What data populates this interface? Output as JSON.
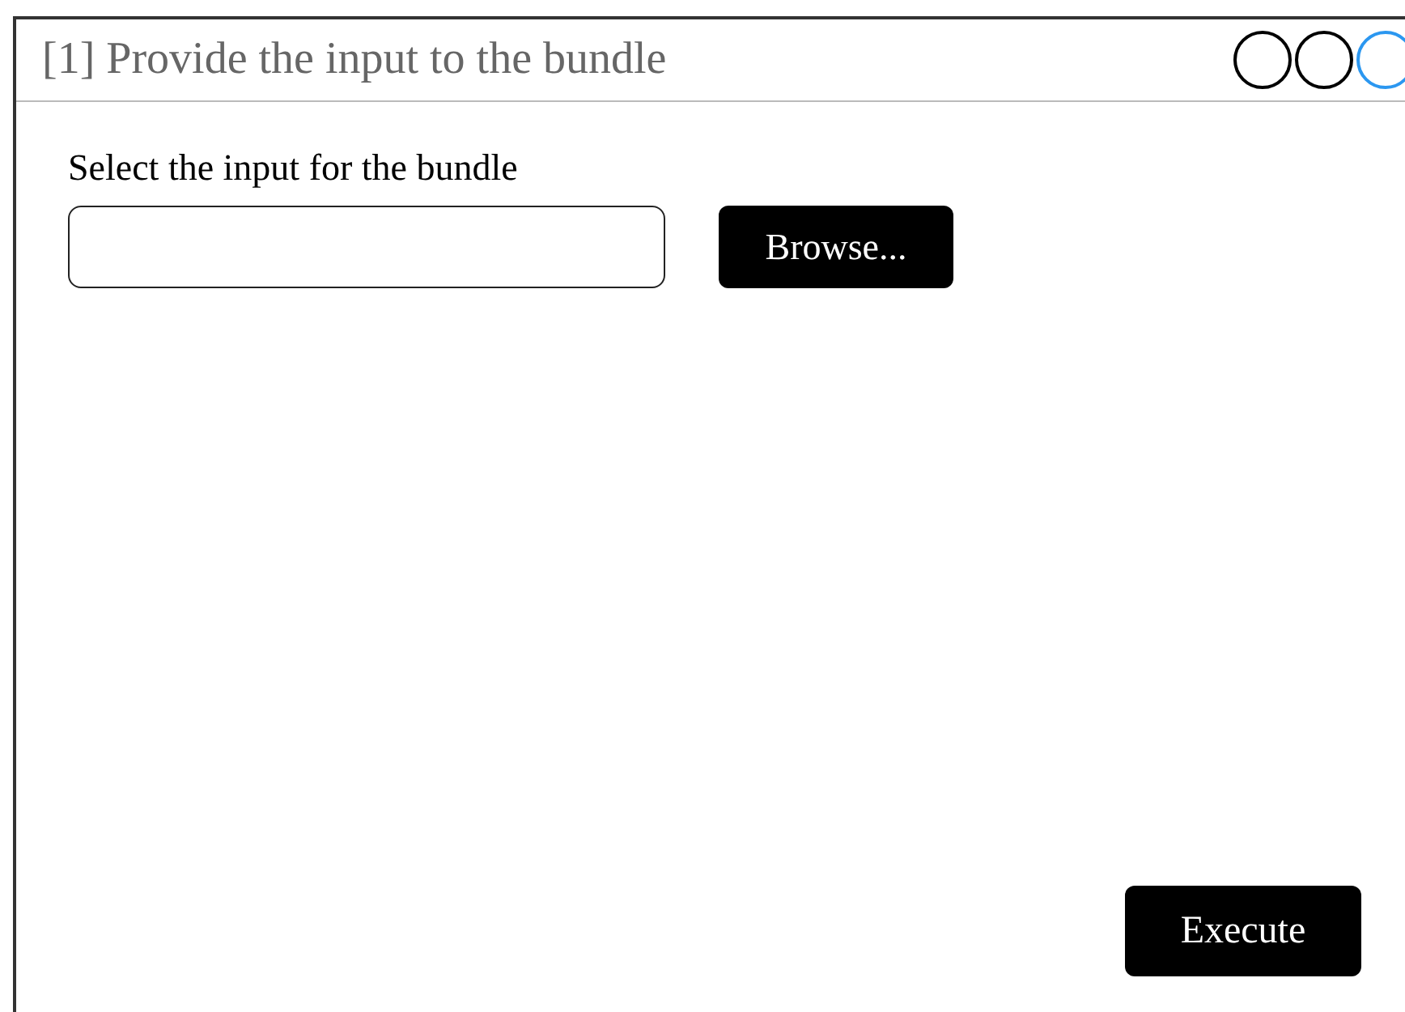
{
  "window": {
    "title": "[1] Provide the input to the bundle",
    "steps": [
      {
        "selected": false
      },
      {
        "selected": false
      },
      {
        "selected": true
      }
    ]
  },
  "form": {
    "label": "Select the input for the bundle",
    "browse_button": "Browse..."
  },
  "execute_button": "Execute"
}
